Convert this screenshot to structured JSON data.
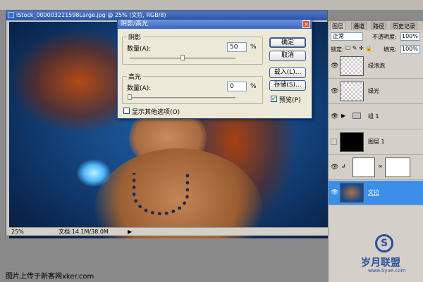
{
  "document": {
    "title": "iStock_000003221598Large.jpg @ 25% (文拉, RGB/8)",
    "zoom": "25%",
    "doc_size": "文档:14.1M/38.0M"
  },
  "dialog": {
    "title": "阴影/高光",
    "close_glyph": "×",
    "shadows": {
      "legend": "阴影",
      "amount_label": "数量(A):",
      "amount_value": "50",
      "unit": "%",
      "slider_fraction": 0.5
    },
    "highlights": {
      "legend": "高光",
      "amount_label": "数量(A):",
      "amount_value": "0",
      "unit": "%",
      "slider_fraction": 0.0
    },
    "show_more_label": "显示其他选项(O)",
    "show_more_checked": false,
    "buttons": {
      "ok": "确定",
      "cancel": "取消",
      "load": "载入(L)...",
      "save": "存储(S)..."
    },
    "preview_label": "预览(P)",
    "preview_checked": true
  },
  "layers_panel": {
    "tabs": [
      "图层",
      "通道",
      "路径",
      "历史记录"
    ],
    "blend_mode": "正常",
    "opacity_label": "不透明度:",
    "opacity_value": "100%",
    "lock_label": "锁定:",
    "fill_label": "填充:",
    "fill_value": "100%",
    "layers": [
      {
        "name": "绿泡泡",
        "visible": true,
        "thumb": "checker"
      },
      {
        "name": "绿光",
        "visible": true,
        "thumb": "checker"
      },
      {
        "name": "组 1",
        "visible": true,
        "thumb": "folder"
      },
      {
        "name": "图层 1",
        "visible": false,
        "thumb": "black"
      },
      {
        "name": "",
        "visible": true,
        "thumb": "adjustment"
      },
      {
        "name": "文拉",
        "visible": true,
        "thumb": "photo",
        "selected": true
      }
    ]
  },
  "footer": {
    "caption": "图片上传于新客网xker.com",
    "watermark_text": "岁月联盟",
    "watermark_url": "www.5yue.com"
  },
  "colors": {
    "accent": "#3d8ee8",
    "titlebar": "#2b55a5"
  }
}
